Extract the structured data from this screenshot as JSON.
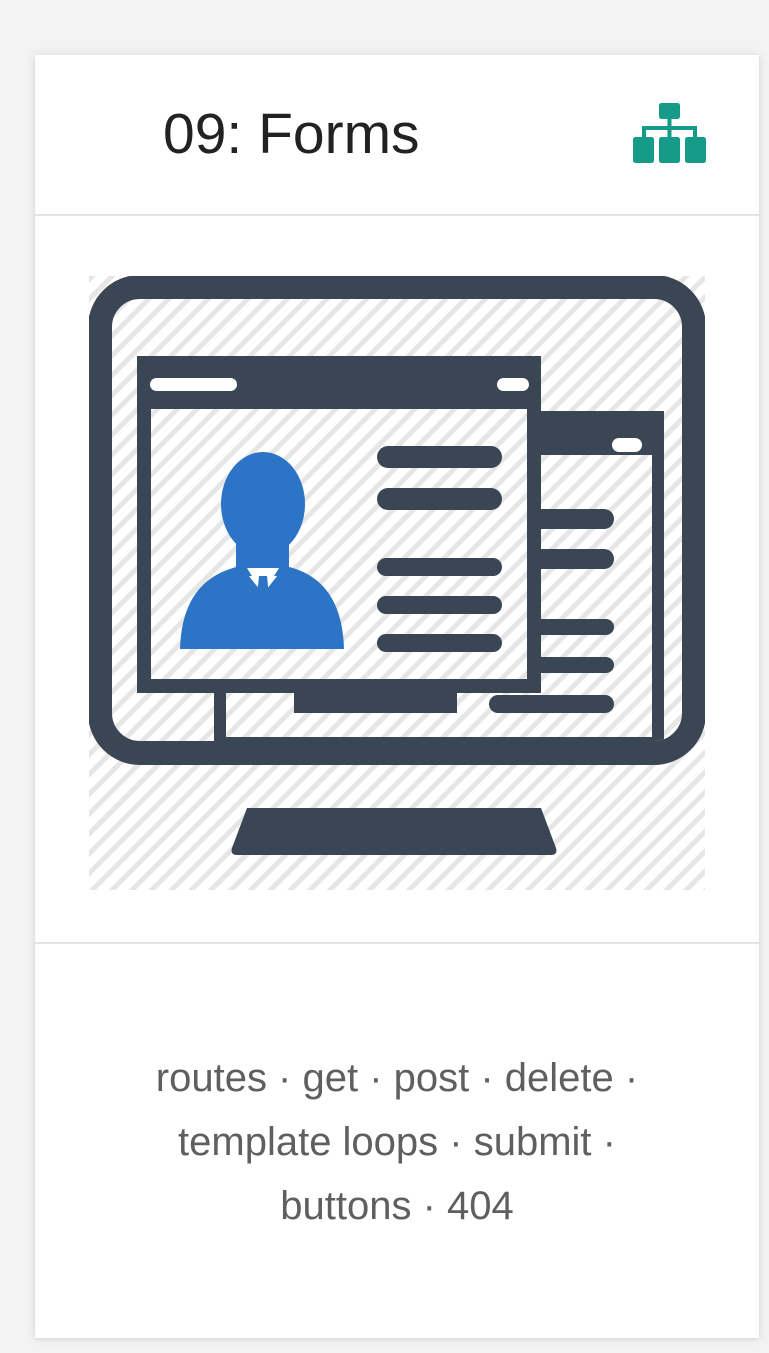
{
  "card": {
    "title": "09: Forms",
    "tags": "routes · get · post · delete · template loops · submit · buttons · 404"
  },
  "icons": {
    "header": "sitemap-icon",
    "illustration": "computer-user-profile-icon"
  },
  "colors": {
    "accent": "#169b88",
    "monitor": "#3a4654",
    "person": "#2c74c6",
    "tags_text": "#5f5f5f"
  }
}
